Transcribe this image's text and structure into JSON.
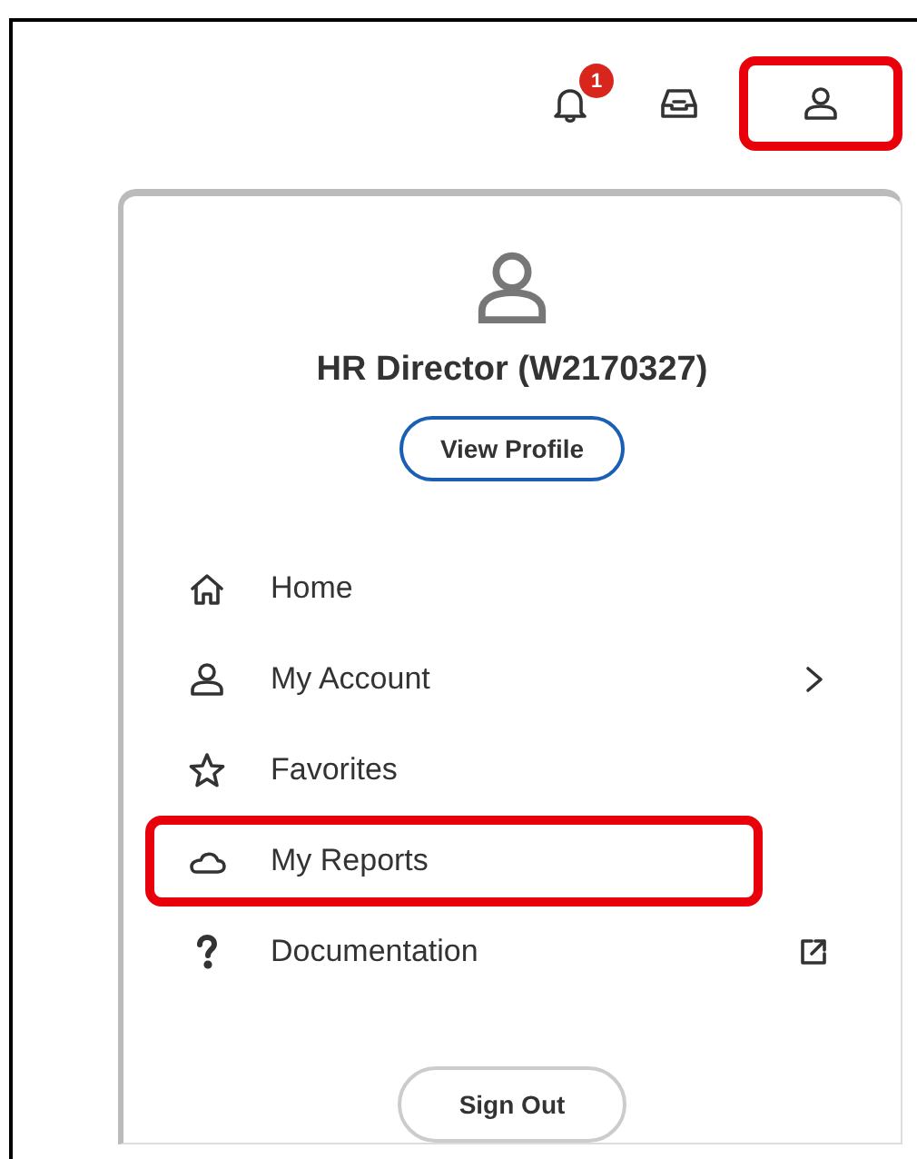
{
  "top_bar": {
    "notification_count": "1",
    "profile_highlighted": true
  },
  "profile": {
    "name": "HR Director (W2170327)",
    "view_profile": "View Profile"
  },
  "menu": [
    {
      "label": "Home",
      "kind": "link",
      "highlighted": false
    },
    {
      "label": "My Account",
      "kind": "submenu",
      "highlighted": false
    },
    {
      "label": "Favorites",
      "kind": "link",
      "highlighted": false
    },
    {
      "label": "My Reports",
      "kind": "link",
      "highlighted": true
    },
    {
      "label": "Documentation",
      "kind": "external",
      "highlighted": false
    }
  ],
  "sign_out": "Sign Out"
}
